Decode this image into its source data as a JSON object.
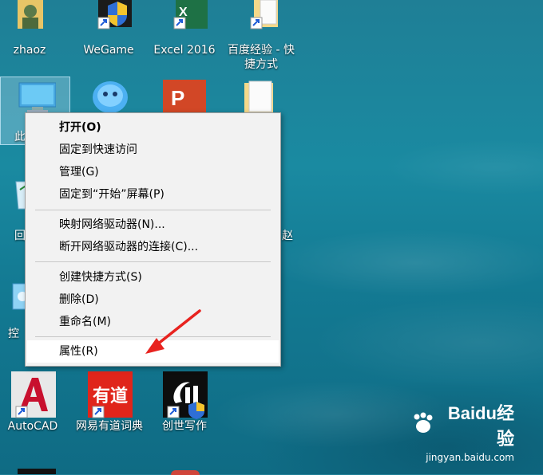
{
  "desktop": {
    "icons": [
      {
        "label": "zhaoz",
        "icon": "user-folder-icon"
      },
      {
        "label": "WeGame",
        "icon": "wegame-icon"
      },
      {
        "label": "Excel 2016",
        "icon": "excel-icon"
      },
      {
        "label": "百度经验 - 快\n捷方式",
        "icon": "folder-shortcut-icon"
      },
      {
        "label": "此",
        "icon": "this-pc-icon"
      },
      {
        "label": "",
        "icon": "qq-icon"
      },
      {
        "label": "",
        "icon": "powerpoint-icon"
      },
      {
        "label": "",
        "icon": "folder-icon"
      },
      {
        "label": "回",
        "icon": "recycle-bin-icon"
      },
      {
        "label": "赵",
        "icon": "user-file-icon"
      },
      {
        "label": "控",
        "icon": "control-panel-icon"
      },
      {
        "label": "AutoCAD",
        "icon": "autocad-icon"
      },
      {
        "label": "网易有道词典",
        "icon": "youdao-icon"
      },
      {
        "label": "创世写作",
        "icon": "chuangshi-icon"
      }
    ]
  },
  "context_menu": {
    "items": [
      {
        "label": "打开(O)",
        "bold": true
      },
      {
        "label": "固定到快速访问"
      },
      {
        "label": "管理(G)"
      },
      {
        "label": "固定到“开始”屏幕(P)"
      },
      {
        "label": "映射网络驱动器(N)..."
      },
      {
        "label": "断开网络驱动器的连接(C)..."
      },
      {
        "label": "创建快捷方式(S)"
      },
      {
        "label": "删除(D)"
      },
      {
        "label": "重命名(M)"
      },
      {
        "label": "属性(R)",
        "highlighted": true
      }
    ]
  },
  "watermark": {
    "brand": "Baidu经验",
    "url": "jingyan.baidu.com"
  },
  "colors": {
    "arrow": "#e8231f",
    "menu_bg": "#f2f2f2",
    "accent_blue": "#1e5bd6"
  }
}
